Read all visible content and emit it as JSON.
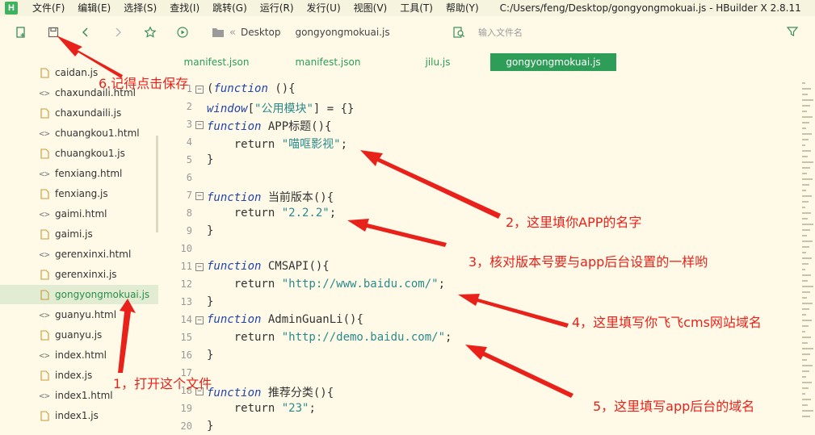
{
  "window": {
    "logo": "H",
    "title": "C:/Users/feng/Desktop/gongyongmokuai.js - HBuilder X 2.8.11"
  },
  "menu": [
    "文件(F)",
    "编辑(E)",
    "选择(S)",
    "查找(I)",
    "跳转(G)",
    "运行(R)",
    "发行(U)",
    "视图(V)",
    "工具(T)",
    "帮助(Y)"
  ],
  "toolbar": {
    "icons": [
      "new-file-icon",
      "save-icon",
      "back-icon",
      "forward-icon",
      "star-icon",
      "run-icon"
    ],
    "breadcrumb": [
      "Desktop",
      "gongyongmokuai.js"
    ],
    "find_placeholder": "输入文件名"
  },
  "sidebar": {
    "files": [
      {
        "name": "caidan.js",
        "type": "js"
      },
      {
        "name": "chaxundaili.html",
        "type": "html"
      },
      {
        "name": "chaxundaili.js",
        "type": "js"
      },
      {
        "name": "chuangkou1.html",
        "type": "html"
      },
      {
        "name": "chuangkou1.js",
        "type": "js"
      },
      {
        "name": "fenxiang.html",
        "type": "html"
      },
      {
        "name": "fenxiang.js",
        "type": "js"
      },
      {
        "name": "gaimi.html",
        "type": "html"
      },
      {
        "name": "gaimi.js",
        "type": "js"
      },
      {
        "name": "gerenxinxi.html",
        "type": "html"
      },
      {
        "name": "gerenxinxi.js",
        "type": "js"
      },
      {
        "name": "gongyongmokuai.js",
        "type": "js",
        "active": true
      },
      {
        "name": "guanyu.html",
        "type": "html"
      },
      {
        "name": "guanyu.js",
        "type": "js"
      },
      {
        "name": "index.html",
        "type": "html"
      },
      {
        "name": "index.js",
        "type": "js"
      },
      {
        "name": "index1.html",
        "type": "html"
      },
      {
        "name": "index1.js",
        "type": "js"
      }
    ]
  },
  "tabs": [
    {
      "label": "manifest.json",
      "active": false
    },
    {
      "label": "manifest.json",
      "active": false
    },
    {
      "label": "jilu.js",
      "active": false
    },
    {
      "label": "gongyongmokuai.js",
      "active": true
    }
  ],
  "code": [
    {
      "n": "1",
      "fold": true,
      "parts": [
        [
          "p",
          "("
        ],
        [
          "k",
          "function"
        ],
        [
          "p",
          " (){"
        ]
      ]
    },
    {
      "n": "2",
      "fold": false,
      "parts": [
        [
          "k",
          "window"
        ],
        [
          "p",
          "["
        ],
        [
          "s",
          "\"公用模块\""
        ],
        [
          "p",
          "] = {}"
        ]
      ]
    },
    {
      "n": "3",
      "fold": true,
      "parts": [
        [
          "k",
          "function"
        ],
        [
          "p",
          " APP标题(){"
        ]
      ]
    },
    {
      "n": "4",
      "fold": false,
      "parts": [
        [
          "p",
          "    return "
        ],
        [
          "s",
          "\"喵哐影视\""
        ],
        [
          "p",
          ";"
        ]
      ]
    },
    {
      "n": "5",
      "fold": false,
      "parts": [
        [
          "p",
          "}"
        ]
      ]
    },
    {
      "n": "6",
      "fold": false,
      "parts": []
    },
    {
      "n": "7",
      "fold": true,
      "parts": [
        [
          "k",
          "function"
        ],
        [
          "p",
          " 当前版本(){"
        ]
      ]
    },
    {
      "n": "8",
      "fold": false,
      "parts": [
        [
          "p",
          "    return "
        ],
        [
          "s",
          "\"2.2.2\""
        ],
        [
          "p",
          ";"
        ]
      ]
    },
    {
      "n": "9",
      "fold": false,
      "parts": [
        [
          "p",
          "}"
        ]
      ]
    },
    {
      "n": "10",
      "fold": false,
      "parts": []
    },
    {
      "n": "11",
      "fold": true,
      "parts": [
        [
          "k",
          "function"
        ],
        [
          "p",
          " CMSAPI(){"
        ]
      ]
    },
    {
      "n": "12",
      "fold": false,
      "parts": [
        [
          "p",
          "    return "
        ],
        [
          "s",
          "\"http://www.baidu.com/\""
        ],
        [
          "p",
          ";"
        ]
      ]
    },
    {
      "n": "13",
      "fold": false,
      "parts": [
        [
          "p",
          "}"
        ]
      ]
    },
    {
      "n": "14",
      "fold": true,
      "parts": [
        [
          "k",
          "function"
        ],
        [
          "p",
          " AdminGuanLi(){"
        ]
      ]
    },
    {
      "n": "15",
      "fold": false,
      "parts": [
        [
          "p",
          "    return "
        ],
        [
          "s",
          "\"http://demo.baidu.com/\""
        ],
        [
          "p",
          ";"
        ]
      ]
    },
    {
      "n": "16",
      "fold": false,
      "parts": [
        [
          "p",
          "}"
        ]
      ]
    },
    {
      "n": "17",
      "fold": false,
      "parts": []
    },
    {
      "n": "18",
      "fold": true,
      "parts": [
        [
          "k",
          "function"
        ],
        [
          "p",
          " 推荐分类(){"
        ]
      ]
    },
    {
      "n": "19",
      "fold": false,
      "parts": [
        [
          "p",
          "    return "
        ],
        [
          "s",
          "\"23\""
        ],
        [
          "p",
          ";"
        ]
      ]
    },
    {
      "n": "20",
      "fold": false,
      "parts": [
        [
          "p",
          "}"
        ]
      ]
    }
  ],
  "annotations": {
    "save": "6.记得点击保存",
    "open_file": "1，打开这个文件",
    "app_name": "2，这里填你APP的名字",
    "version": "3，核对版本号要与app后台设置的一样哟",
    "cms_domain": "4，这里填写你飞飞cms网站域名",
    "admin_domain": "5，这里填写app后台的域名"
  },
  "colors": {
    "accent": "#2e9d58",
    "annotation": "#e8221b",
    "background": "#fffae8"
  }
}
